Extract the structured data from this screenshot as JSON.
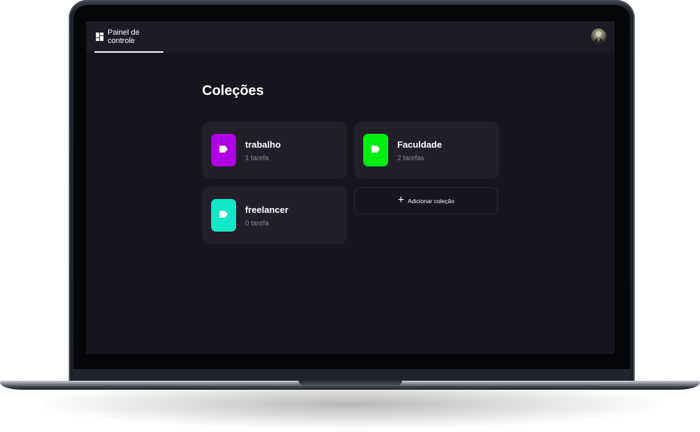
{
  "topbar": {
    "tab_label": "Painel de controle",
    "tab_icon": "dashboard-icon",
    "avatar_icon": "user-avatar"
  },
  "main": {
    "title": "Coleções",
    "collections": [
      {
        "name": "trabalho",
        "count": "1 tarefa",
        "color": "#b000e6",
        "icon": "tag-icon"
      },
      {
        "name": "Faculdade",
        "count": "2 tarefas",
        "color": "#00ee11",
        "icon": "tag-icon"
      },
      {
        "name": "freelancer",
        "count": "0 tarefa",
        "color": "#12e8c8",
        "icon": "tag-icon"
      }
    ],
    "add_button_label": "Adicionar coleção",
    "add_icon": "+"
  },
  "colors": {
    "background": "#17151e",
    "topbar": "#1d1b24",
    "card": "#221f2b",
    "text": "#ffffff",
    "muted_text": "#8f8c98"
  }
}
